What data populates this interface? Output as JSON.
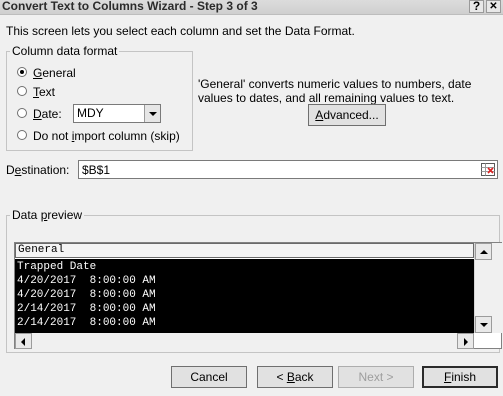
{
  "window": {
    "title": "Convert Text to Columns Wizard - Step 3 of 3",
    "help_label": "?",
    "close_label": "✕"
  },
  "instructions": "This screen lets you select each column and set the Data Format.",
  "column_format": {
    "legend": "Column data format",
    "options": [
      {
        "pre": "",
        "ul": "G",
        "post": "eneral",
        "checked": true
      },
      {
        "pre": "",
        "ul": "T",
        "post": "ext",
        "checked": false
      },
      {
        "pre": "",
        "ul": "D",
        "post": "ate:",
        "checked": false
      },
      {
        "pre": "Do not ",
        "ul": "i",
        "post": "mport column (skip)",
        "checked": false
      }
    ],
    "date_format_value": "MDY"
  },
  "general_note": "'General' converts numeric values to numbers, date values to dates, and all remaining values to text.",
  "advanced_button": {
    "pre": "",
    "ul": "A",
    "post": "dvanced..."
  },
  "destination": {
    "pre": "D",
    "ul": "e",
    "post": "stination:",
    "value": "$B$1"
  },
  "preview": {
    "legend_pre": "Data ",
    "legend_ul": "p",
    "legend_post": "review",
    "column_header": "General",
    "rows": [
      "Trapped Date",
      "4/20/2017  8:00:00 AM",
      "4/20/2017  8:00:00 AM",
      "2/14/2017  8:00:00 AM",
      "2/14/2017  8:00:00 AM"
    ]
  },
  "buttons": {
    "cancel": "Cancel",
    "back_pre": "< ",
    "back_ul": "B",
    "back_post": "ack",
    "next": "Next >",
    "finish_ul": "F",
    "finish_post": "inish"
  }
}
